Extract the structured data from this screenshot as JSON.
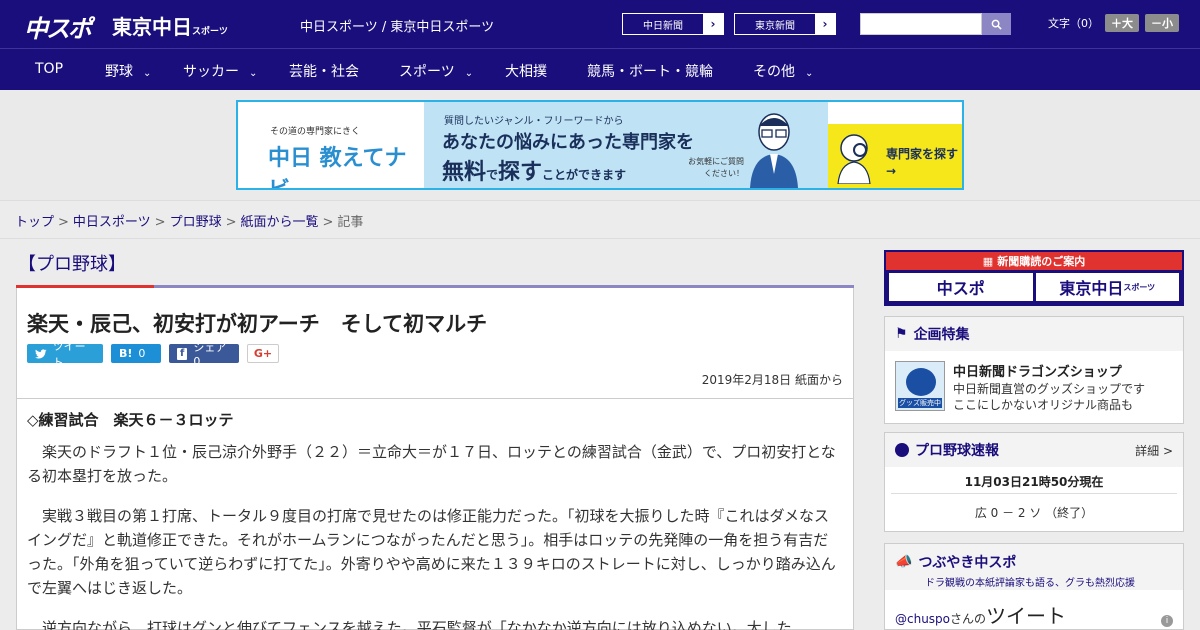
{
  "header": {
    "logo_main": "中スポ",
    "logo_tokyo": "東京中日",
    "logo_tokyo_small": "スポーツ",
    "site_name": "中日スポーツ / 東京中日スポーツ",
    "btn_chunichi": "中日新聞",
    "btn_tokyo": "東京新聞",
    "btn_arrow": "›",
    "search_icon": "search-icon",
    "font_label": "文字（0）",
    "font_plus": "＋大",
    "font_minus": "－小"
  },
  "nav": {
    "items": [
      {
        "label": "TOP"
      },
      {
        "label": "野球"
      },
      {
        "label": "サッカー"
      },
      {
        "label": "芸能・社会"
      },
      {
        "label": "スポーツ"
      },
      {
        "label": "大相撲"
      },
      {
        "label": "競馬・ボート・競輪"
      },
      {
        "label": "その他"
      }
    ],
    "chevron": "⌄"
  },
  "banner": {
    "small": "その道の専門家にきく",
    "big": "中日 教えてナビ",
    "line1": "質問したいジャンル・フリーワードから",
    "line2": "あなたの悩みにあった専門家を",
    "line3_a": "無料",
    "line3_b": "で",
    "line3_c": "探す",
    "line3_d": "ことができます",
    "note": "お気軽にご質問ください！",
    "cta": "専門家を探す →"
  },
  "breadcrumb": {
    "items": [
      "トップ",
      "中日スポーツ",
      "プロ野球",
      "紙面から一覧"
    ],
    "current": "記事",
    "sep": ">"
  },
  "article": {
    "category": "【プロ野球】",
    "title": "楽天・辰己、初安打が初アーチ　そして初マルチ",
    "share": {
      "tweet": "ツイート",
      "hatena": "0",
      "facebook": "シェア 0",
      "gplus": "G+"
    },
    "date": "2019年2月18日 紙面から",
    "subhead": "◇練習試合　楽天６－３ロッテ",
    "paragraphs": [
      "　楽天のドラフト１位・辰己涼介外野手（２２）＝立命大＝が１７日、ロッテとの練習試合（金武）で、プロ初安打となる初本塁打を放った。",
      "　実戦３戦目の第１打席、トータル９度目の打席で見せたのは修正能力だった。「初球を大振りした時『これはダメなスイングだ』と軌道修正できた。それがホームランにつながったんだと思う」。相手はロッテの先発陣の一角を担う有吉だった。「外角を狙っていて逆らわずに打てた」。外寄りやや高めに来た１３９キロのストレートに対し、しっかり踏み込んで左翼へはじき返した。",
      "　逆方向ながら、打球はグンと伸びてフェンスを越えた。平石監督が「なかなか逆方向には放り込めない。大した"
    ]
  },
  "sidebar": {
    "subscribe": {
      "top": "新聞購読のご案内",
      "logo_a": "中スポ",
      "logo_b": "東京中日",
      "logo_b_small": "スポーツ"
    },
    "feature": {
      "head": "企画特集",
      "title": "中日新聞ドラゴンズショップ",
      "desc1": "中日新聞直営のグッズショップです",
      "desc2": "ここにしかないオリジナル商品も",
      "img_tag": "グッズ販売中"
    },
    "scores": {
      "head": "プロ野球速報",
      "more": "詳細 >",
      "time": "11月03日21時50分現在",
      "line": "広 0 － 2 ソ （終了）"
    },
    "tweet": {
      "head": "つぶやき中スポ",
      "sub": "ドラ観戦の本紙評論家も語る、グラも熱烈応援",
      "user": "@chuspo",
      "suffix": "さんの",
      "word": "ツイート"
    }
  },
  "colors": {
    "brand": "#1a0e7c",
    "accent_red": "#e0322e",
    "banner_border": "#2bb2e6"
  }
}
